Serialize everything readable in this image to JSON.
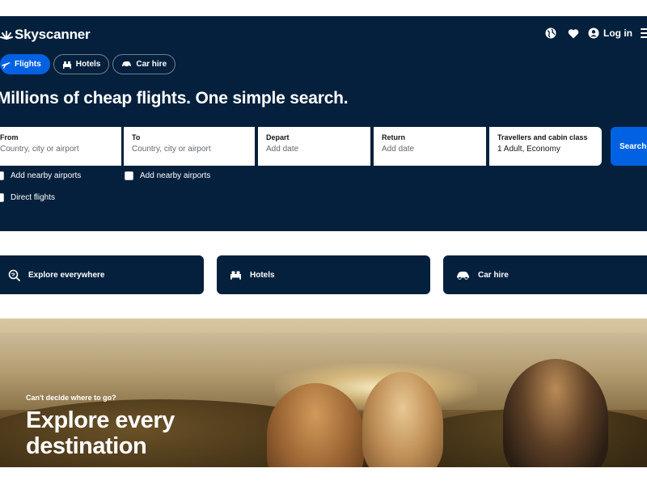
{
  "brand": {
    "name": "Skyscanner"
  },
  "header": {
    "login_label": "Log in"
  },
  "tabs": [
    {
      "label": "Flights",
      "icon": "plane-icon",
      "active": true
    },
    {
      "label": "Hotels",
      "icon": "bed-icon",
      "active": false
    },
    {
      "label": "Car hire",
      "icon": "car-icon",
      "active": false
    }
  ],
  "headline": "Millions of cheap flights. One simple search.",
  "search": {
    "from": {
      "label": "From",
      "placeholder": "Country, city or airport"
    },
    "to": {
      "label": "To",
      "placeholder": "Country, city or airport"
    },
    "depart": {
      "label": "Depart",
      "placeholder": "Add date"
    },
    "return": {
      "label": "Return",
      "placeholder": "Add date"
    },
    "travellers": {
      "label": "Travellers and cabin class",
      "value": "1 Adult, Economy"
    },
    "button_label": "Search"
  },
  "options": {
    "nearby_from": "Add nearby airports",
    "nearby_to": "Add nearby airports",
    "direct": "Direct flights"
  },
  "quick_links": [
    {
      "label": "Explore everywhere",
      "icon": "explore-icon"
    },
    {
      "label": "Hotels",
      "icon": "bed-icon"
    },
    {
      "label": "Car hire",
      "icon": "car-icon"
    }
  ],
  "promo": {
    "eyebrow": "Can't decide where to go?",
    "title": "Explore every destination"
  },
  "colors": {
    "navy": "#05203c",
    "accent_blue": "#0062e3",
    "white": "#ffffff"
  }
}
